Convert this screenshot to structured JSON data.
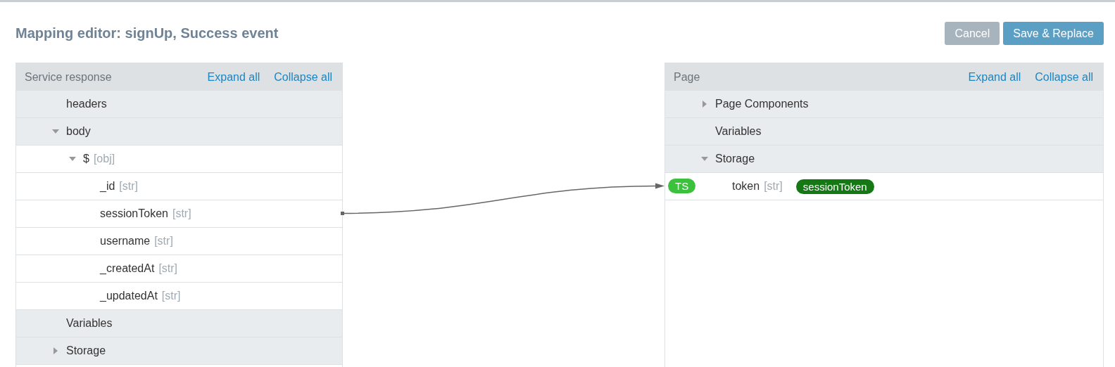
{
  "title": "Mapping editor: signUp, Success event",
  "buttons": [
    {
      "label": "Cancel",
      "kind": "secondary"
    },
    {
      "label": "Save & Replace",
      "kind": "primary"
    }
  ],
  "source": {
    "title": "Service response",
    "expand_all": "Expand all",
    "collapse_all": "Collapse all",
    "items": [
      {
        "name": "headers"
      },
      {
        "name": "body",
        "expanded": true,
        "children": [
          {
            "name": "$",
            "type": "[obj]",
            "expanded": true,
            "children": [
              {
                "name": "_id",
                "type": "[str]"
              },
              {
                "name": "sessionToken",
                "type": "[str]",
                "mapped": true
              },
              {
                "name": "username",
                "type": "[str]"
              },
              {
                "name": "_createdAt",
                "type": "[str]"
              },
              {
                "name": "_updatedAt",
                "type": "[str]"
              }
            ]
          }
        ]
      },
      {
        "name": "Variables"
      },
      {
        "name": "Storage",
        "expanded": false
      }
    ]
  },
  "target": {
    "title": "Page",
    "expand_all": "Expand all",
    "collapse_all": "Collapse all",
    "items": [
      {
        "name": "Page Components",
        "expanded": false
      },
      {
        "name": "Variables"
      },
      {
        "name": "Storage",
        "expanded": true,
        "children": [
          {
            "name": "token",
            "type": "[str]",
            "badge": "TS",
            "mapping": "sessionToken",
            "mapped": true
          }
        ]
      }
    ]
  }
}
